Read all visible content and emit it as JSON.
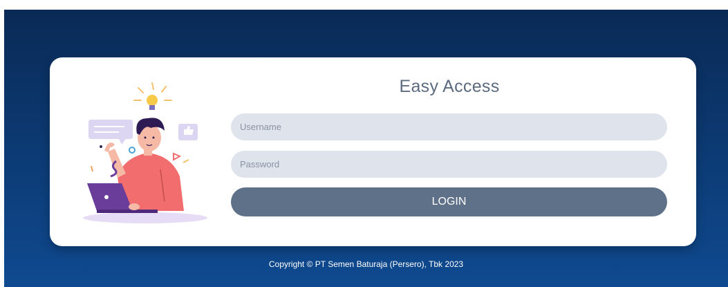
{
  "login": {
    "title": "Easy Access",
    "username_placeholder": "Username",
    "password_placeholder": "Password",
    "button_label": "LOGIN"
  },
  "footer": {
    "copyright": "Copyright © PT Semen Baturaja (Persero), Tbk 2023"
  },
  "illustration": {
    "icon": "person-with-laptop-illustration"
  },
  "colors": {
    "background_top": "#0a2a55",
    "background_bottom": "#0f4a90",
    "card": "#ffffff",
    "input_fill": "#dfe3ec",
    "button": "#5f7189",
    "title_text": "#5d6b80",
    "shirt": "#f26d6d",
    "laptop": "#6a3d9a"
  }
}
